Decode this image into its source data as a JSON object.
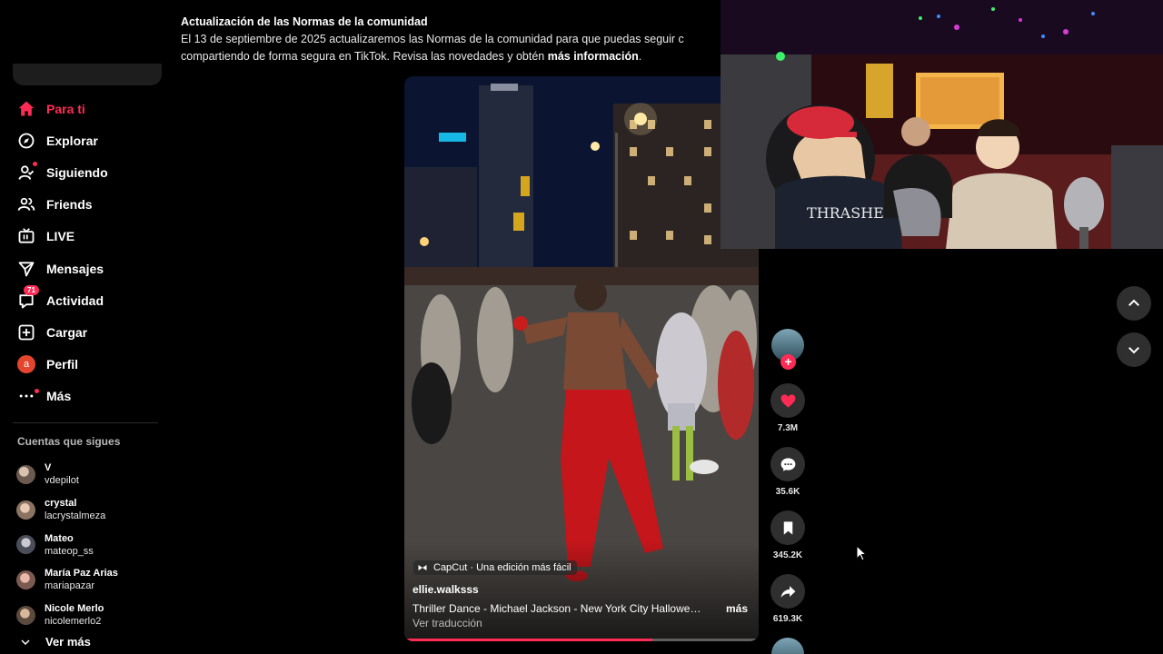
{
  "sidebar": {
    "nav": [
      {
        "label": "Para ti",
        "icon": "home-icon",
        "active": true
      },
      {
        "label": "Explorar",
        "icon": "compass-icon"
      },
      {
        "label": "Siguiendo",
        "icon": "following-icon"
      },
      {
        "label": "Friends",
        "icon": "friends-icon"
      },
      {
        "label": "LIVE",
        "icon": "live-icon"
      },
      {
        "label": "Mensajes",
        "icon": "messages-icon"
      },
      {
        "label": "Actividad",
        "icon": "activity-icon",
        "badge": "71"
      },
      {
        "label": "Cargar",
        "icon": "upload-icon"
      },
      {
        "label": "Perfil",
        "icon": "profile-avatar",
        "avatar_letter": "a"
      },
      {
        "label": "Más",
        "icon": "more-icon"
      }
    ],
    "following_title": "Cuentas que sigues",
    "accounts": [
      {
        "name": "V",
        "username": "vdepilot"
      },
      {
        "name": "crystal",
        "username": "lacrystalmeza"
      },
      {
        "name": "Mateo",
        "username": "mateop_ss"
      },
      {
        "name": "María Paz Arias",
        "username": "mariapazar"
      },
      {
        "name": "Nicole Merlo",
        "username": "nicolemerlo2"
      }
    ],
    "see_more": "Ver más"
  },
  "notice": {
    "title": "Actualización de las Normas de la comunidad",
    "line1": "El 13 de septiembre de 2025 actualizaremos las Normas de la comunidad para que puedas seguir c",
    "line2": "compartiendo de forma segura en TikTok. Revisa las novedades y obtén ",
    "link": "más información",
    "link_suffix": "."
  },
  "video": {
    "capcut_label": "CapCut · Una edición más fácil",
    "author": "ellie.walksss",
    "caption": "Thriller Dance - Michael Jackson - New York City Halloween ...",
    "more": "más",
    "translate": "Ver traducción",
    "progress": 0.7
  },
  "actions": {
    "likes": "7.3M",
    "comments": "35.6K",
    "saves": "345.2K",
    "shares": "619.3K"
  },
  "colors": {
    "accent": "#fe2c55",
    "background": "#000000",
    "button_bg": "#2f2f2f"
  }
}
